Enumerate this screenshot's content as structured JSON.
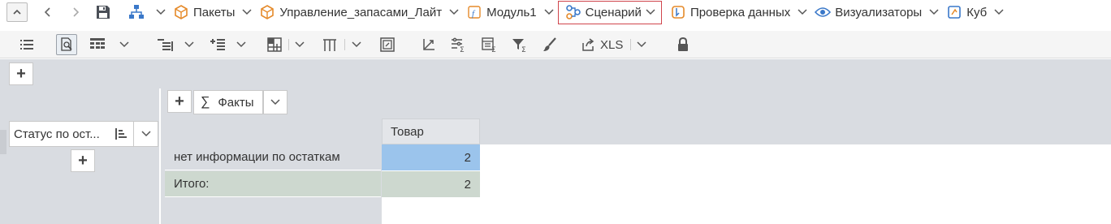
{
  "breadcrumbs": [
    {
      "label": "Пакеты",
      "icon": "package-icon"
    },
    {
      "label": "Управление_запасами_Лайт",
      "icon": "package-icon"
    },
    {
      "label": "Модуль1",
      "icon": "module-icon"
    },
    {
      "label": "Сценарий",
      "icon": "scenario-icon",
      "active": true
    },
    {
      "label": "Проверка данных",
      "icon": "data-check-icon"
    },
    {
      "label": "Визуализаторы",
      "icon": "eye-icon"
    },
    {
      "label": "Куб",
      "icon": "cube-icon"
    }
  ],
  "toolbar": {
    "export_label": "XLS"
  },
  "pivot": {
    "facts_label": "Факты",
    "row_dimension_label": "Статус по ост...",
    "column_header": "Товар",
    "rows": [
      {
        "label": "нет информации по остаткам",
        "value": "2"
      },
      {
        "label": "Итого:",
        "value": "2"
      }
    ]
  },
  "colors": {
    "active_border": "#d0454c",
    "selected_cell": "#9bc4ec",
    "total_row": "#cdd8cf",
    "pane_gray": "#d9dce1"
  }
}
